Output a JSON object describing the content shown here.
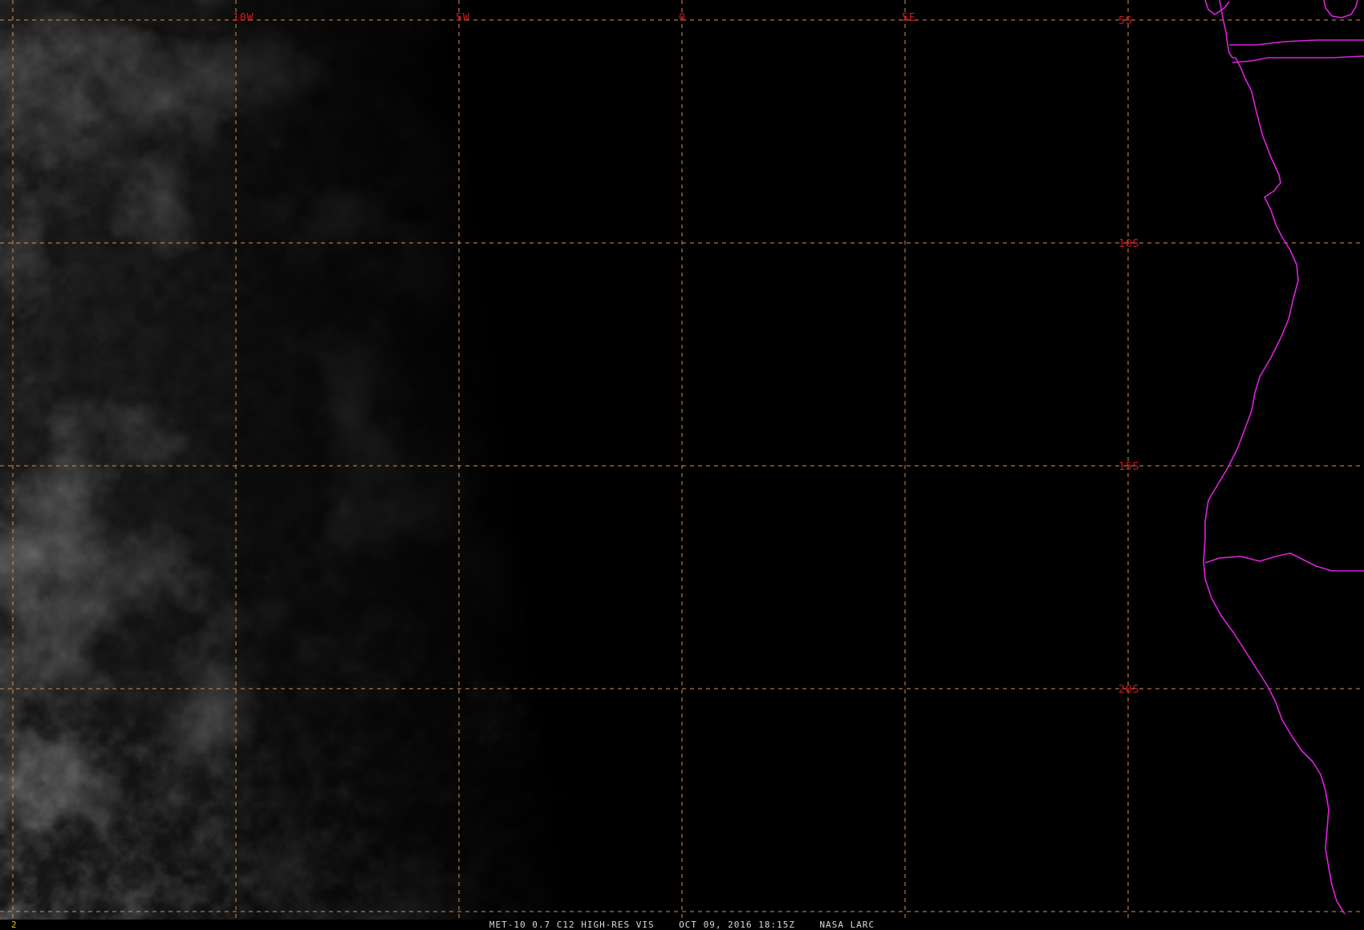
{
  "map": {
    "frame_number": "2",
    "caption": {
      "product": "MET-10 0.7 C12 HIGH-RES VIS",
      "datetime": "OCT 09, 2016 18:15Z",
      "source": "NASA LARC"
    },
    "colors": {
      "background": "#000000",
      "grid": "#d89050",
      "grid_labels": "#d01818",
      "coastline": "#e020e0",
      "frame_number": "#e8c800",
      "caption": "#d8d8d8"
    },
    "longitude_lines": [
      {
        "label": "10W",
        "lon": -10
      },
      {
        "label": "5W",
        "lon": -5
      },
      {
        "label": "0",
        "lon": 0
      },
      {
        "label": "5E",
        "lon": 5
      }
    ],
    "latitude_lines": [
      {
        "label": "5S",
        "lat": -5
      },
      {
        "label": "10S",
        "lat": -10
      },
      {
        "label": "15S",
        "lat": -15
      },
      {
        "label": "20S",
        "lat": -20
      }
    ]
  }
}
